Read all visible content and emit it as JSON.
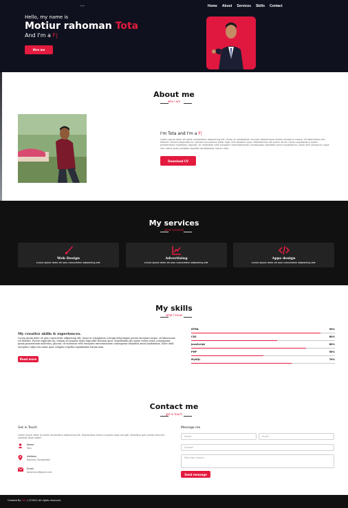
{
  "nav": {
    "logo_text": "•••",
    "items": [
      "Home",
      "About",
      "Services",
      "Skills",
      "Contact"
    ]
  },
  "hero": {
    "greeting": "Hello, my name is",
    "name_first": "Motiur rahoman",
    "name_accent": "Tota",
    "role_prefix": "And I'm a",
    "role_typed": "F|",
    "button_label": "Hire me"
  },
  "about": {
    "title": "About me",
    "subtitle": "who I am",
    "heading_prefix": "I'm Tota and I'm a",
    "heading_typed": "F|",
    "text": "Lorem ipsum dolor sit amet consectetur adipisicing elit. Quasi ut voluptatum corrupti doloremque autem excepturi neque, sit laboriosam est deleniti. Facere explicabo hic veniam accusamus dolor fuga nihil dolorem quos. Repellendus illo omnis rerum nemo consequatur ipsam praesentium molestias, placeat, sit molestiae velit excepturi exercitationem consequatur blanditiis animi laudantium. Dolor nihil excepturi culpa rem natus quas voluptas repellat repudiandae harum nam.",
    "button_label": "Download CV"
  },
  "services": {
    "title": "My services",
    "subtitle": "what I provide",
    "cards": [
      {
        "icon": "paint-brush-icon",
        "title": "Web Design",
        "text": "Lorem ipsum dolor sit ame consectetur adipisicing elit."
      },
      {
        "icon": "chart-line-icon",
        "title": "Advertising",
        "text": "Lorem ipsum dolor sit ame consectetur adipisicing elit."
      },
      {
        "icon": "code-icon",
        "title": "Apps design",
        "text": "Lorem ipsum dolor sit ame consectetur adipisicing elit."
      }
    ]
  },
  "skills": {
    "title": "My skills",
    "subtitle": "what I know",
    "heading": "My creative skills & experiences.",
    "text": "Lorem ipsum dolor sit ame consectetur adipisicing elit. Quasi ut voluptatum corrupti doloremque autem excepturi neque, sit laboriosam est deleniti. Facere explicabo hic veniam accusamus dolor fuga nihil dolorem quos. Repellendus illo omnis rerum nemo consequatur ipsam praesentium molestias, placeat, sit molestiae velit excepturi exercitationem consequatur blanditiis animi laudantium. Dolor nihil excepturi culpa rem natus quas voluptas repellat repudiandae harum nam.",
    "button_label": "Read more",
    "bars": [
      {
        "name": "HTML",
        "percent_label": "90%",
        "fill": 0.9
      },
      {
        "name": "CSS",
        "percent_label": "60%",
        "fill": 0.6
      },
      {
        "name": "JavaScript",
        "percent_label": "80%",
        "fill": 0.8
      },
      {
        "name": "PHP",
        "percent_label": "50%",
        "fill": 0.5
      },
      {
        "name": "MySQL",
        "percent_label": "70%",
        "fill": 0.7
      }
    ]
  },
  "contact": {
    "title": "Contact me",
    "subtitle": "get in touch",
    "left_title": "Get in Touch",
    "left_text": "Lorem ipsum dolor sit amet consectetur adipisicing elit. Dignissimos harum corporis fuga corrupti. Doloribus quis soluta nesciunt veritatis vitae nobis?",
    "info": [
      {
        "icon": "user-icon",
        "label": "Name",
        "value": "Tota"
      },
      {
        "icon": "map-marker-icon",
        "label": "Address",
        "value": "Rajshahi, Bangladesh"
      },
      {
        "icon": "envelope-icon",
        "label": "Email",
        "value": "totamotiur@gmail.com"
      }
    ],
    "right_title": "Message me",
    "name_placeholder": "Name",
    "email_placeholder": "Email",
    "subject_placeholder": "Subject",
    "message_placeholder": "Describe project...",
    "send_label": "Send message"
  },
  "footer": {
    "prefix": "Created By",
    "accent": "Tota",
    "suffix": "| ©2022 All rights reserved."
  },
  "colors": {
    "accent": "#e31b3f",
    "hero_bg": "#10111e",
    "section_dark": "#111111"
  }
}
